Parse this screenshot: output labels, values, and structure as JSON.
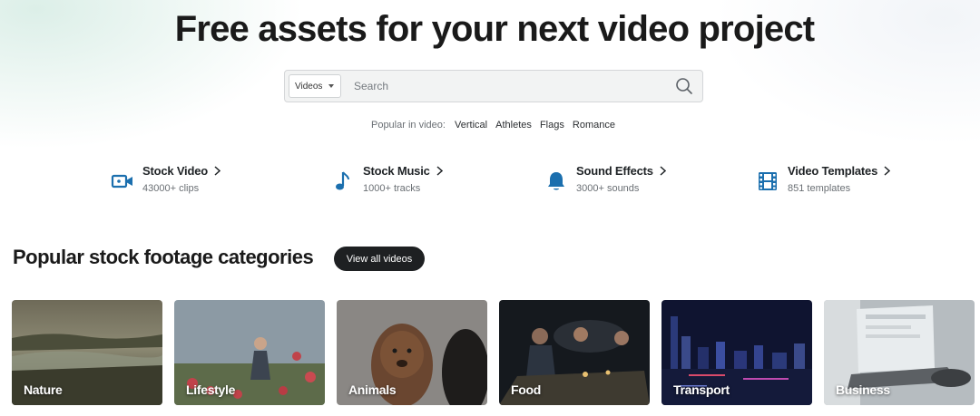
{
  "hero": {
    "title": "Free assets for your next video project"
  },
  "search": {
    "type_selected": "Videos",
    "placeholder": "Search",
    "value": ""
  },
  "popular": {
    "lead": "Popular in video:",
    "terms": [
      "Vertical",
      "Athletes",
      "Flags",
      "Romance"
    ]
  },
  "assets": [
    {
      "name": "Stock Video",
      "count": "43000+ clips",
      "icon": "video-camera-icon"
    },
    {
      "name": "Stock Music",
      "count": "1000+ tracks",
      "icon": "music-note-icon"
    },
    {
      "name": "Sound Effects",
      "count": "3000+ sounds",
      "icon": "bell-icon"
    },
    {
      "name": "Video Templates",
      "count": "851 templates",
      "icon": "film-strip-icon"
    }
  ],
  "categories_section": {
    "title": "Popular stock footage categories",
    "view_all_label": "View all videos"
  },
  "categories": [
    {
      "label": "Nature"
    },
    {
      "label": "Lifestyle"
    },
    {
      "label": "Animals"
    },
    {
      "label": "Food"
    },
    {
      "label": "Transport"
    },
    {
      "label": "Business"
    }
  ],
  "colors": {
    "accent": "#1b6fae",
    "dark_button": "#1e2022",
    "text": "#1a1a1a",
    "muted": "#6a6f74"
  }
}
